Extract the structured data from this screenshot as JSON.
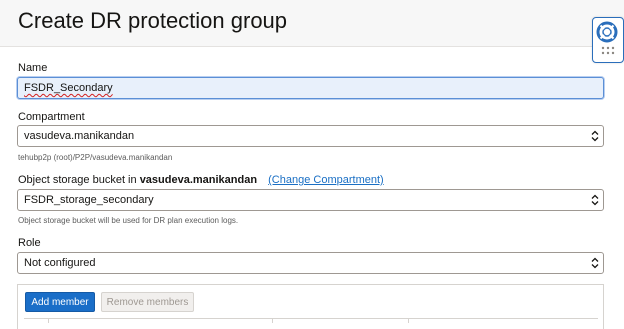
{
  "header": {
    "title": "Create DR protection group"
  },
  "form": {
    "name": {
      "label": "Name",
      "value": "FSDR_Secondary"
    },
    "compartment": {
      "label": "Compartment",
      "value": "vasudeva.manikandan",
      "path": "tehubp2p (root)/P2P/vasudeva.manikandan"
    },
    "bucket": {
      "label_prefix": "Object storage bucket in",
      "label_compartment": "vasudeva.manikandan",
      "change_link": "(Change Compartment)",
      "value": "FSDR_storage_secondary",
      "helper": "Object storage bucket will be used for DR plan execution logs."
    },
    "role": {
      "label": "Role",
      "value": "Not configured"
    }
  },
  "members": {
    "add_label": "Add member",
    "remove_label": "Remove members"
  },
  "icons": {
    "help": "lifebuoy-icon",
    "select": "chevron-updown-icon"
  },
  "colors": {
    "primary": "#1a6ec8",
    "link": "#1a6fc4",
    "active_input_bg": "#e8f0fb"
  }
}
